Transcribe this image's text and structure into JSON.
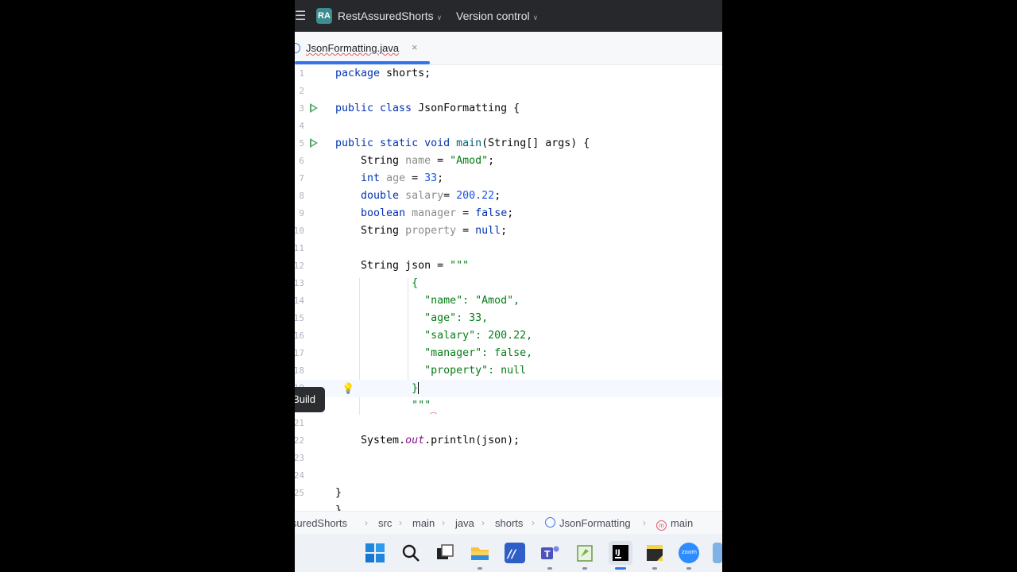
{
  "titlebar": {
    "menu_icon": "hamburger-menu-icon",
    "project_badge": "RA",
    "project_name": "RestAssuredShorts",
    "version_control": "Version control"
  },
  "tab": {
    "filename": "JsonFormatting.java",
    "close": "×"
  },
  "editor": {
    "line_numbers": [
      "1",
      "2",
      "3",
      "4",
      "5",
      "6",
      "7",
      "8",
      "9",
      "10",
      "11",
      "12",
      "13",
      "14",
      "15",
      "16",
      "17",
      "18",
      "19",
      "20",
      "21",
      "22",
      "23",
      "24",
      "25"
    ],
    "current_line": 19
  },
  "tooltip": {
    "build": "Build"
  },
  "breadcrumb": {
    "items": [
      "RestAssuredShorts",
      "src",
      "main",
      "java",
      "shorts",
      "JsonFormatting",
      "main"
    ]
  },
  "taskbar": {
    "icons": [
      "windows-start-icon",
      "search-icon",
      "task-view-icon",
      "file-explorer-icon",
      "visual-studio-icon",
      "teams-icon",
      "notepad-plus-icon",
      "intellij-icon",
      "sticky-notes-icon",
      "zoom-icon",
      "app-icon"
    ],
    "zoom_label": "zoom"
  },
  "colors": {
    "keyword": "#0033b3",
    "string": "#067d17",
    "number": "#1750eb",
    "accent": "#3574f0",
    "run_gutter": "#59a869"
  }
}
